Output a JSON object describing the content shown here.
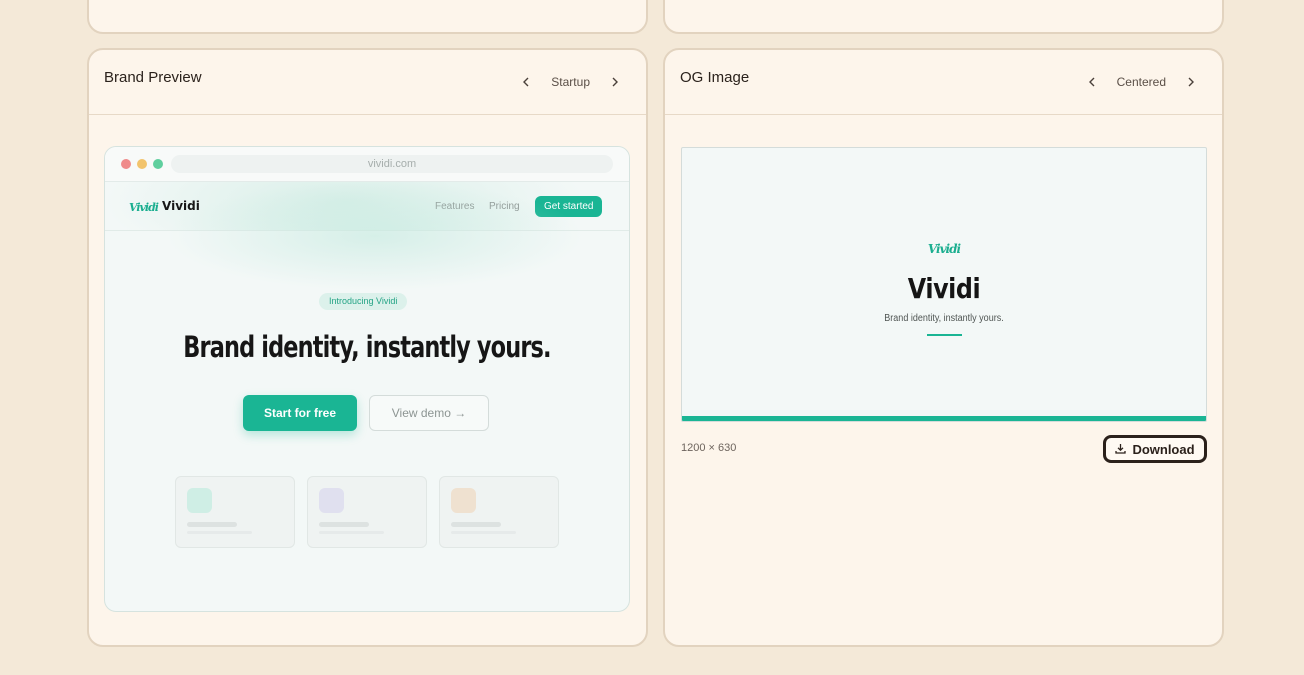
{
  "brand_card": {
    "title": "Brand Preview",
    "variant": "Startup",
    "url": "vividi.com",
    "site": {
      "logo_mark": "Vividi",
      "logo_text": "Vividi",
      "nav_features": "Features",
      "nav_pricing": "Pricing",
      "nav_cta": "Get started",
      "pill": "Introducing Vividi",
      "headline": "Brand identity, instantly yours.",
      "primary_button": "Start for free",
      "secondary_button": "View demo →"
    },
    "feature_colors": [
      "#cfeee5",
      "#e0e0ef",
      "#efe1d0"
    ]
  },
  "og_card": {
    "title": "OG Image",
    "variant": "Centered",
    "og_mark": "Vividi",
    "og_title": "Vividi",
    "og_subtitle": "Brand identity, instantly yours.",
    "dimensions": "1200 × 630",
    "download_label": "Download"
  },
  "colors": {
    "accent": "#1ab594",
    "card_bg": "#fdf5eb",
    "page_bg": "#f4e9d8"
  }
}
